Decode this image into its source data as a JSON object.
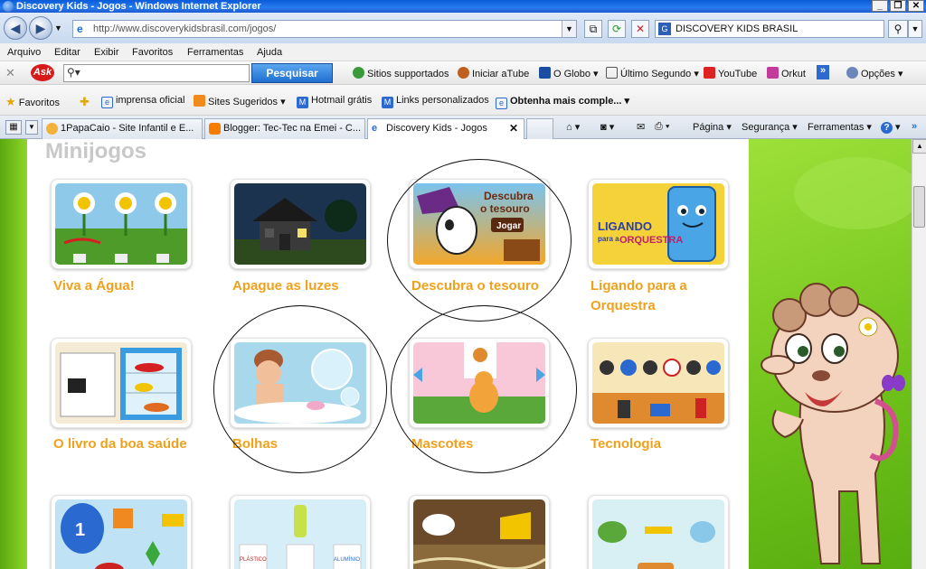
{
  "window": {
    "title": "Discovery Kids - Jogos - Windows Internet Explorer"
  },
  "address": {
    "url": "http://www.discoverykidsbrasil.com/jogos/",
    "search_text": "DISCOVERY KIDS BRASIL"
  },
  "menu": [
    "Arquivo",
    "Editar",
    "Exibir",
    "Favoritos",
    "Ferramentas",
    "Ajuda"
  ],
  "ask_toolbar": {
    "logo": "Ask",
    "search_button": "Pesquisar",
    "items": [
      "Sitios supportados",
      "Iniciar aTube",
      "O Globo",
      "Último Segundo",
      "YouTube",
      "Orkut"
    ],
    "overflow": "»",
    "options": "Opções"
  },
  "favorites_bar": {
    "favorites_label": "Favoritos",
    "items": [
      "imprensa oficial",
      "Sites Sugeridos",
      "Hotmail grátis",
      "Links personalizados",
      "Obtenha mais comple..."
    ]
  },
  "tabs": [
    {
      "label": "1PapaCaio - Site Infantil e E...",
      "active": false
    },
    {
      "label": "Blogger: Tec-Tec na Emei - C...",
      "active": false
    },
    {
      "label": "Discovery Kids - Jogos",
      "active": true
    }
  ],
  "command_bar": [
    "Página",
    "Segurança",
    "Ferramentas"
  ],
  "page": {
    "section_title": "Minijogos",
    "games": [
      {
        "name": "Viva a Água!",
        "circled": false,
        "icon": "flowers-thumbnail"
      },
      {
        "name": "Apague as luzes",
        "circled": false,
        "icon": "night-house-thumbnail"
      },
      {
        "name": "Descubra o tesouro",
        "circled": true,
        "icon": "treasure-dog-thumbnail",
        "thumb_text": [
          "Descubra",
          "o tesouro",
          "Jogar"
        ]
      },
      {
        "name": "Ligando para a Orquestra",
        "circled": false,
        "icon": "phone-orchestra-thumbnail",
        "thumb_text": [
          "LIGANDO",
          "para a",
          "ORQUESTRA"
        ]
      },
      {
        "name": "O livro da boa saúde",
        "circled": false,
        "icon": "fridge-book-thumbnail"
      },
      {
        "name": "Bolhas",
        "circled": true,
        "icon": "bath-bubbles-thumbnail"
      },
      {
        "name": "Mascotes",
        "circled": true,
        "icon": "pet-cat-thumbnail"
      },
      {
        "name": "Tecnologia",
        "circled": false,
        "icon": "telephones-thumbnail"
      },
      {
        "name": "",
        "circled": false,
        "icon": "balloon-shapes-thumbnail",
        "thumb_text": [
          "1"
        ]
      },
      {
        "name": "",
        "circled": false,
        "icon": "bottles-thumbnail",
        "thumb_text": [
          "PLÁSTICO",
          "ALUMÍNIO"
        ]
      },
      {
        "name": "",
        "circled": false,
        "icon": "farm-cheese-thumbnail"
      },
      {
        "name": "",
        "circled": false,
        "icon": "animals-instruments-thumbnail"
      }
    ]
  },
  "colors": {
    "game_title": "#f0a11c",
    "page_green": "#7ccf22",
    "title_bar": "#0a5bd8",
    "search_button": "#1f6fd0"
  }
}
